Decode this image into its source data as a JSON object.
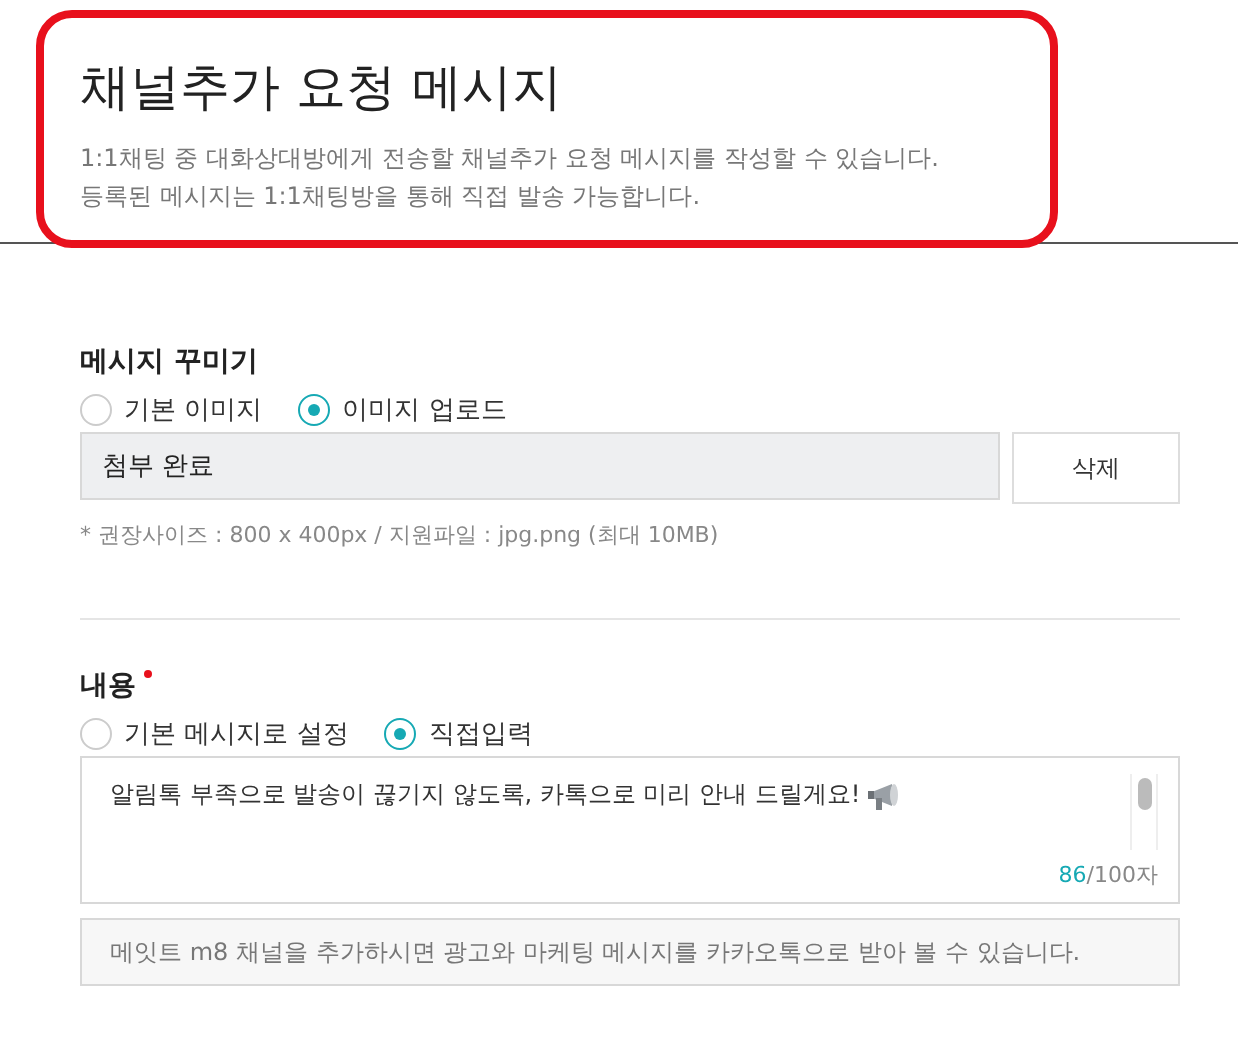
{
  "header": {
    "title": "채널추가 요청 메시지",
    "description": [
      "1:1채팅 중 대화상대방에게 전송할 채널추가 요청 메시지를 작성할 수 있습니다.",
      "등록된 메시지는 1:1채팅방을 통해 직접 발송 가능합니다."
    ]
  },
  "image_section": {
    "heading": "메시지 꾸미기",
    "options": [
      {
        "label": "기본 이미지",
        "selected": false
      },
      {
        "label": "이미지 업로드",
        "selected": true
      }
    ],
    "file_field": {
      "value": "첨부 완료"
    },
    "delete_button": "삭제",
    "hint": "* 권장사이즈 : 800 x 400px / 지원파일 : jpg.png (최대 10MB)"
  },
  "content_section": {
    "heading": "내용",
    "required": true,
    "options": [
      {
        "label": "기본 메시지로 설정",
        "selected": false
      },
      {
        "label": "직접입력",
        "selected": true
      }
    ],
    "message": {
      "value": "알림톡 부족으로 발송이 끊기지 않도록, 카톡으로 미리 안내 드릴게요!",
      "count": "86",
      "limit": "/100자"
    },
    "footer_text": "메잇트 m8 채널을 추가하시면 광고와 마케팅 메시지를 카카오톡으로 받아 볼 수 있습니다."
  }
}
